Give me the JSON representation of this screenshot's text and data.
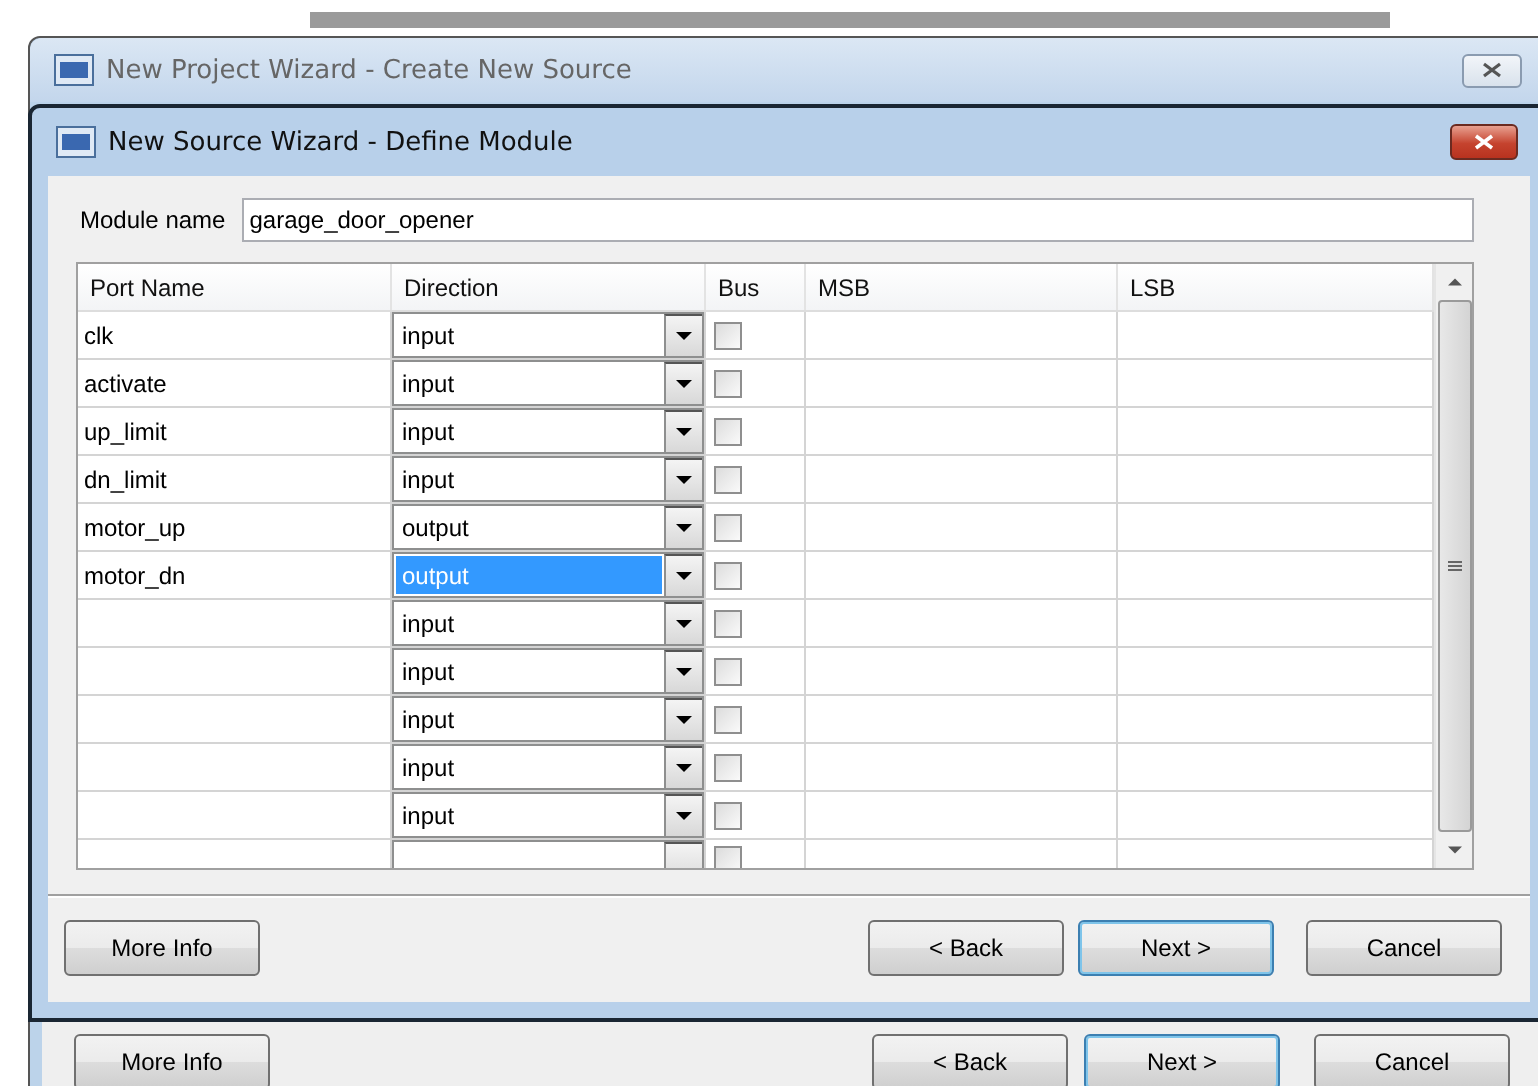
{
  "back_window": {
    "title": "New Project Wizard - Create New Source",
    "buttons": [
      {
        "label": "More Info",
        "default": false
      },
      {
        "label": "< Back",
        "default": false
      },
      {
        "label": "Next >",
        "default": true
      },
      {
        "label": "Cancel",
        "default": false
      }
    ]
  },
  "window": {
    "title": "New Source Wizard - Define Module"
  },
  "module_name": {
    "label": "Module name",
    "value": "garage_door_opener"
  },
  "table": {
    "columns": [
      "Port Name",
      "Direction",
      "Bus",
      "MSB",
      "LSB"
    ],
    "rows": [
      {
        "port_name": "clk",
        "direction": "input",
        "bus": false,
        "selected": false
      },
      {
        "port_name": "activate",
        "direction": "input",
        "bus": false,
        "selected": false
      },
      {
        "port_name": "up_limit",
        "direction": "input",
        "bus": false,
        "selected": false
      },
      {
        "port_name": "dn_limit",
        "direction": "input",
        "bus": false,
        "selected": false
      },
      {
        "port_name": "motor_up",
        "direction": "output",
        "bus": false,
        "selected": false
      },
      {
        "port_name": "motor_dn",
        "direction": "output",
        "bus": false,
        "selected": true
      },
      {
        "direction": "input",
        "bus": false,
        "selected": false
      },
      {
        "direction": "input",
        "bus": false,
        "selected": false
      },
      {
        "direction": "input",
        "bus": false,
        "selected": false
      },
      {
        "direction": "input",
        "bus": false,
        "selected": false
      },
      {
        "direction": "input",
        "bus": false,
        "selected": false
      }
    ],
    "partial_row": {
      "bus": false
    }
  },
  "buttons": [
    {
      "label": "More Info",
      "default": false
    },
    {
      "label": "< Back",
      "default": false
    },
    {
      "label": "Next >",
      "default": true
    },
    {
      "label": "Cancel",
      "default": false
    }
  ]
}
